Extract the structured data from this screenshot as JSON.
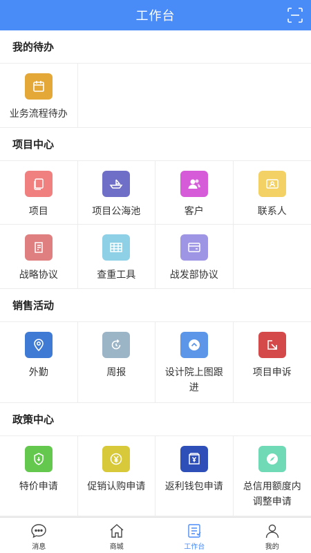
{
  "header": {
    "title": "工作台",
    "scan_icon": "scan-icon"
  },
  "colors": {
    "primary": "#4a8cf7"
  },
  "sections": [
    {
      "title": "我的待办",
      "items": [
        {
          "label": "业务流程待办",
          "icon": "calendar-icon",
          "color": "#e4a838"
        }
      ]
    },
    {
      "title": "项目中心",
      "items": [
        {
          "label": "项目",
          "icon": "document-icon",
          "color": "#f08080"
        },
        {
          "label": "项目公海池",
          "icon": "boat-icon",
          "color": "#6f6fc7"
        },
        {
          "label": "客户",
          "icon": "users-icon",
          "color": "#d55bd9"
        },
        {
          "label": "联系人",
          "icon": "contact-card-icon",
          "color": "#f3d164"
        },
        {
          "label": "战略协议",
          "icon": "agreement-icon",
          "color": "#e07f7f"
        },
        {
          "label": "查重工具",
          "icon": "table-icon",
          "color": "#8ed0e6"
        },
        {
          "label": "战发部协议",
          "icon": "wallet-icon",
          "color": "#9e95e4"
        }
      ]
    },
    {
      "title": "销售活动",
      "items": [
        {
          "label": "外勤",
          "icon": "location-icon",
          "color": "#3f7ad4"
        },
        {
          "label": "周报",
          "icon": "refresh-icon",
          "color": "#9bb4c6"
        },
        {
          "label": "设计院上图跟进",
          "icon": "chevron-up-circle-icon",
          "color": "#5b96e8"
        },
        {
          "label": "项目申诉",
          "icon": "arrow-box-icon",
          "color": "#d44a4a"
        }
      ]
    },
    {
      "title": "政策中心",
      "items": [
        {
          "label": "特价申请",
          "icon": "price-tag-icon",
          "color": "#64c84e"
        },
        {
          "label": "促销认购申请",
          "icon": "yen-coin-icon",
          "color": "#d7c93a"
        },
        {
          "label": "返利钱包申请",
          "icon": "yen-wallet-icon",
          "color": "#2f4fb8"
        },
        {
          "label": "总信用额度内调整申请",
          "icon": "compass-icon",
          "color": "#6fdab5"
        }
      ]
    }
  ],
  "tabbar": [
    {
      "label": "消息",
      "icon": "chat-icon"
    },
    {
      "label": "商城",
      "icon": "home-icon"
    },
    {
      "label": "工作台",
      "icon": "workbench-icon",
      "active": true
    },
    {
      "label": "我的",
      "icon": "user-icon"
    }
  ]
}
